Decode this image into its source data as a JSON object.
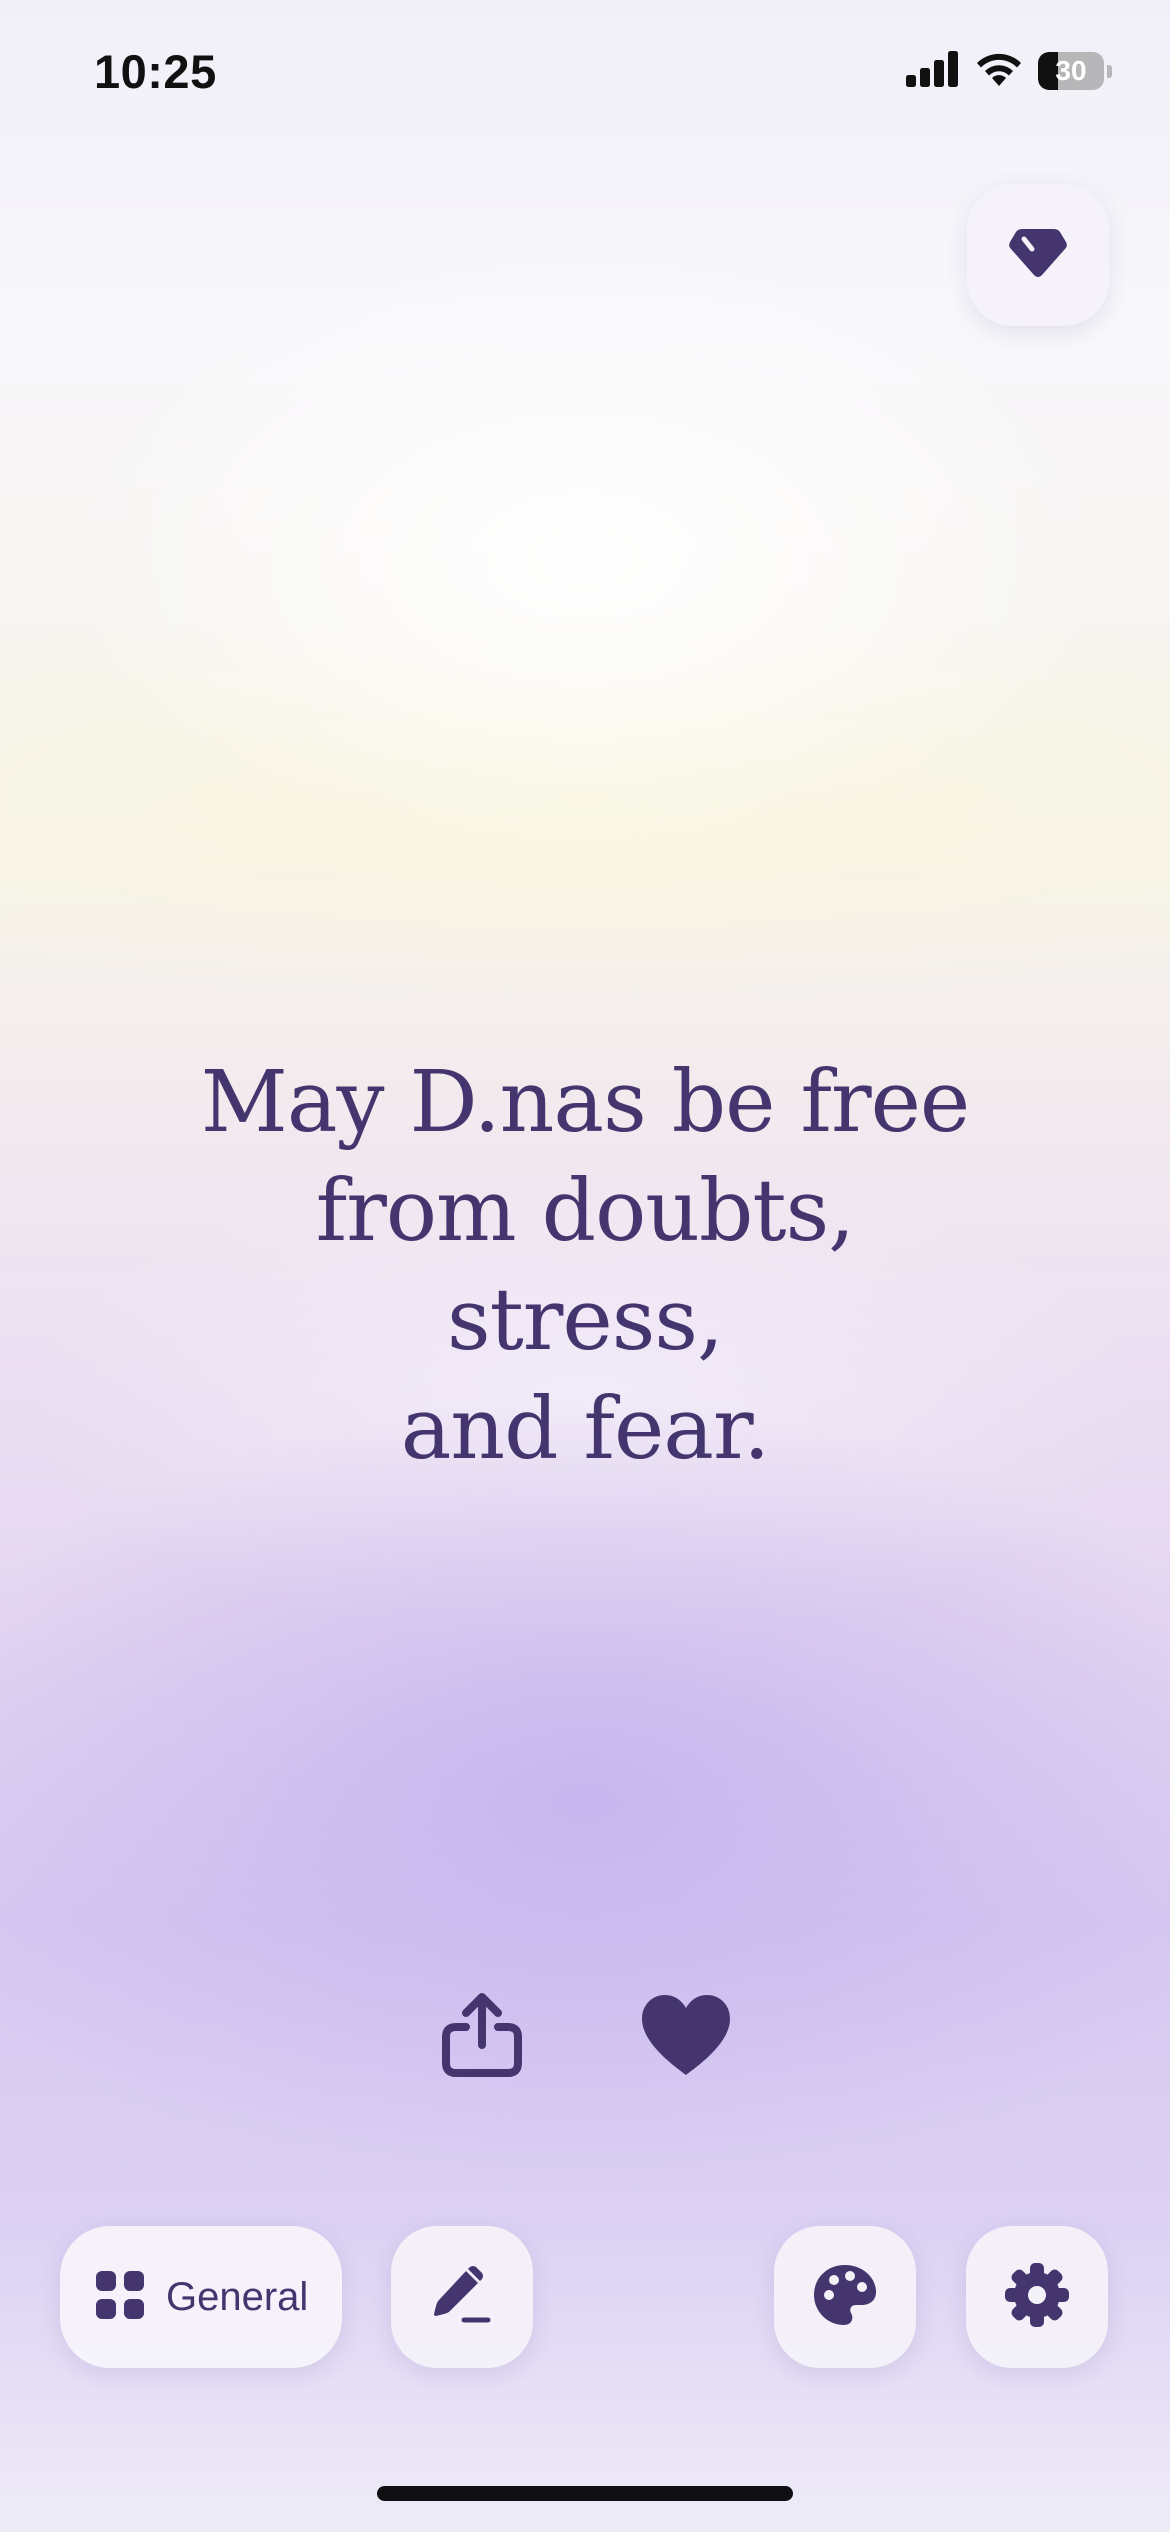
{
  "status_bar": {
    "time": "10:25",
    "battery_level": "30",
    "battery_fraction": 0.3
  },
  "quote": {
    "lines": [
      "May D.nas be free",
      "from doubts,",
      "stress,",
      "and fear."
    ]
  },
  "toolbar": {
    "category_label": "General"
  },
  "colors": {
    "accent": "#44356f",
    "button_bg": "#f4f2f9",
    "background_top": "#f1eff8",
    "background_bottom": "#d6c9f1"
  },
  "icons": {
    "premium": "diamond-icon",
    "share": "share-icon",
    "like": "heart-icon",
    "category": "grid-icon",
    "edit": "pencil-icon",
    "theme": "palette-icon",
    "settings": "gear-icon"
  }
}
